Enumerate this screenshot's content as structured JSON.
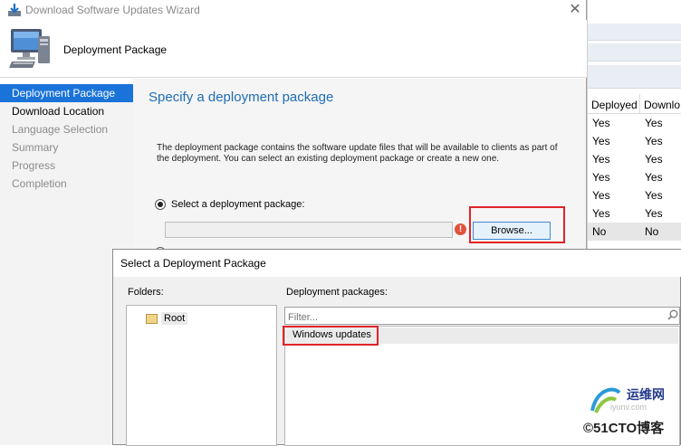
{
  "window": {
    "title": "Download Software Updates Wizard",
    "close_glyph": "✕"
  },
  "header": {
    "title": "Deployment Package",
    "icon": "computer-icon"
  },
  "nav": {
    "items": [
      {
        "label": "Deployment Package",
        "state": "active"
      },
      {
        "label": "Download Location",
        "state": "enabled"
      },
      {
        "label": "Language Selection",
        "state": "disabled"
      },
      {
        "label": "Summary",
        "state": "disabled"
      },
      {
        "label": "Progress",
        "state": "disabled"
      },
      {
        "label": "Completion",
        "state": "disabled"
      }
    ]
  },
  "content": {
    "heading": "Specify a deployment package",
    "description": "The deployment package contains the software update files that will be available to clients as part of the deployment. You can select an existing deployment package or create a new one.",
    "select_existing_label": "Select a deployment package:",
    "package_path_value": "",
    "browse_label": "Browse...",
    "error_glyph": "!"
  },
  "dialog": {
    "title": "Select a Deployment Package",
    "folders_label": "Folders:",
    "root_label": "Root",
    "packages_label": "Deployment packages:",
    "filter_placeholder": "Filter...",
    "packages": [
      "Windows updates"
    ]
  },
  "background_list": {
    "columns": [
      "Deployed",
      "Downlo"
    ],
    "rows": [
      [
        "Yes",
        "Yes"
      ],
      [
        "Yes",
        "Yes"
      ],
      [
        "Yes",
        "Yes"
      ],
      [
        "Yes",
        "Yes"
      ],
      [
        "Yes",
        "Yes"
      ],
      [
        "Yes",
        "Yes"
      ],
      [
        "No",
        "No"
      ]
    ]
  },
  "watermark": {
    "line1": "运维网",
    "line2": "iyunv.com",
    "line3": "©51CTO博客"
  },
  "colors": {
    "accent": "#1a73d9",
    "heading": "#1f6db5",
    "highlight_border": "#e0242a",
    "error": "#e0533c"
  }
}
